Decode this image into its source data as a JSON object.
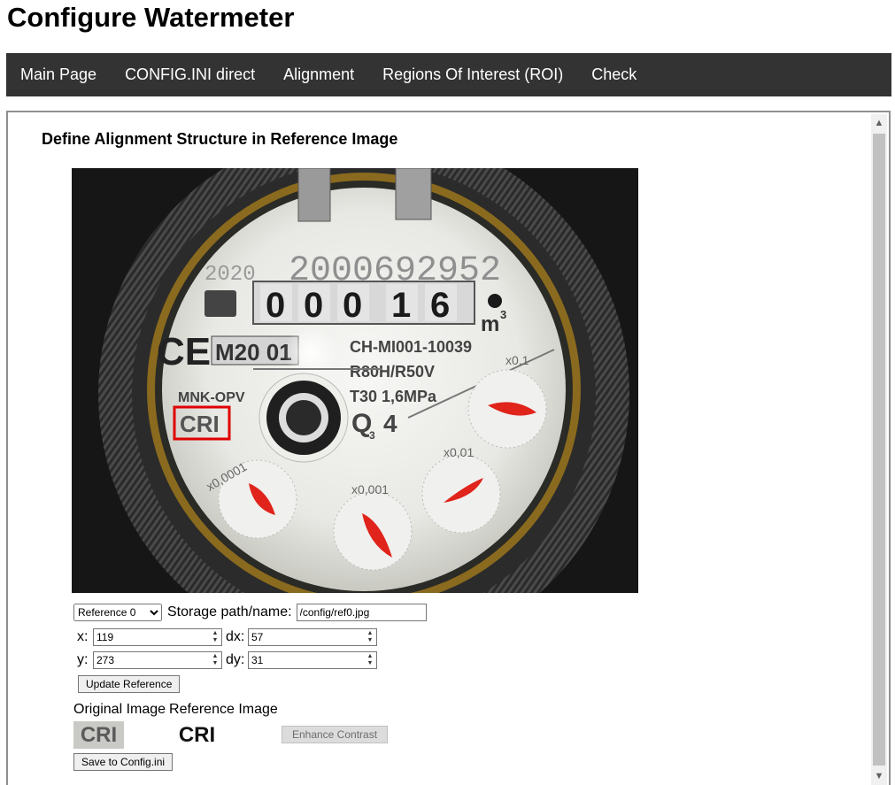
{
  "page": {
    "title": "Configure Watermeter"
  },
  "nav": [
    {
      "label": "Main Page"
    },
    {
      "label": "CONFIG.INI direct"
    },
    {
      "label": "Alignment"
    },
    {
      "label": "Regions Of Interest (ROI)"
    },
    {
      "label": "Check"
    }
  ],
  "content": {
    "heading": "Define Alignment Structure in Reference Image",
    "image": {
      "meter_digits": [
        "0",
        "0",
        "0",
        "1",
        "6"
      ],
      "unit": "m",
      "unit_superscript": "3",
      "serial": "2000692952",
      "year": "2020",
      "model": "CH-MI001-10039",
      "ratio": "R80H/R50V",
      "temp_pressure": "T30  1,6MPa",
      "maker": "MNK-OPV",
      "cri": "CRI",
      "q": "Q",
      "q_sub": "3",
      "q_val": "4",
      "mark": "M20 01",
      "ce": "CE",
      "dial_labels": [
        "x0,1",
        "x0,01",
        "x0,001",
        "x0,0001"
      ],
      "colors": {
        "needle": "#e0241b",
        "roi_box": "#e00000"
      }
    },
    "reference": {
      "select_value": "Reference 0",
      "storage_label": "Storage path/name:",
      "storage_value": "/config/ref0.jpg",
      "x_label": "x:",
      "x_value": "119",
      "dx_label": "dx:",
      "dx_value": "57",
      "y_label": "y:",
      "y_value": "273",
      "dy_label": "dy:",
      "dy_value": "31",
      "update_button": "Update Reference",
      "original_label": "Original Image",
      "reference_label": "Reference Image",
      "original_text": "CRI",
      "reference_text": "CRI",
      "enhance_button": "Enhance Contrast",
      "save_button": "Save to Config.ini"
    }
  }
}
